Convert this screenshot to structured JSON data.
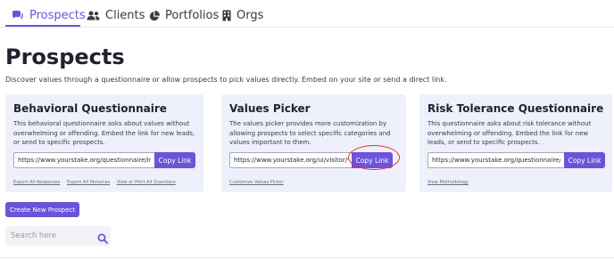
{
  "tabs": [
    {
      "label": "Prospects",
      "icon": "prospects-icon",
      "active": true
    },
    {
      "label": "Clients",
      "icon": "people-icon",
      "active": false
    },
    {
      "label": "Portfolios",
      "icon": "pie-chart-icon",
      "active": false
    },
    {
      "label": "Orgs",
      "icon": "building-icon",
      "active": false
    }
  ],
  "page": {
    "title": "Prospects",
    "intro": "Discover values through a questionnaire or allow prospects to pick values directly. Embed on your site or send a direct link."
  },
  "cards": [
    {
      "title": "Behavioral Questionnaire",
      "description": "This behavioral questionnaire asks about values without overwhelming or offending. Embed the link for new leads, or send to specific prospects.",
      "link": "https://www.yourstake.org/questionnaire/intro/",
      "button": "Copy Link",
      "links": [
        "Export All Responses",
        "Export All Personas",
        "View or Print All Questions"
      ]
    },
    {
      "title": "Values Picker",
      "description": "The values picker provides more customization by allowing prospects to select specific categories and values important to them.",
      "link": "https://www.yourstake.org/ui/visitor/wz",
      "button": "Copy Link",
      "links": [
        "Customize Values Picker"
      ]
    },
    {
      "title": "Risk Tolerance Questionnaire",
      "description": "This questionnaire asks about risk tolerance without overwhelming or offending. Embed the link for new leads, or send to specific prospects.",
      "link": "https://www.yourstake.org/questionnaire/intro/",
      "button": "Copy Link",
      "links": [
        "View Methodology"
      ]
    }
  ],
  "actions": {
    "create_prospect": "Create New Prospect"
  },
  "search": {
    "placeholder": "Search here"
  },
  "colors": {
    "accent": "#6c54d8",
    "card_bg": "#eef0fb",
    "highlight": "#e0352b"
  }
}
